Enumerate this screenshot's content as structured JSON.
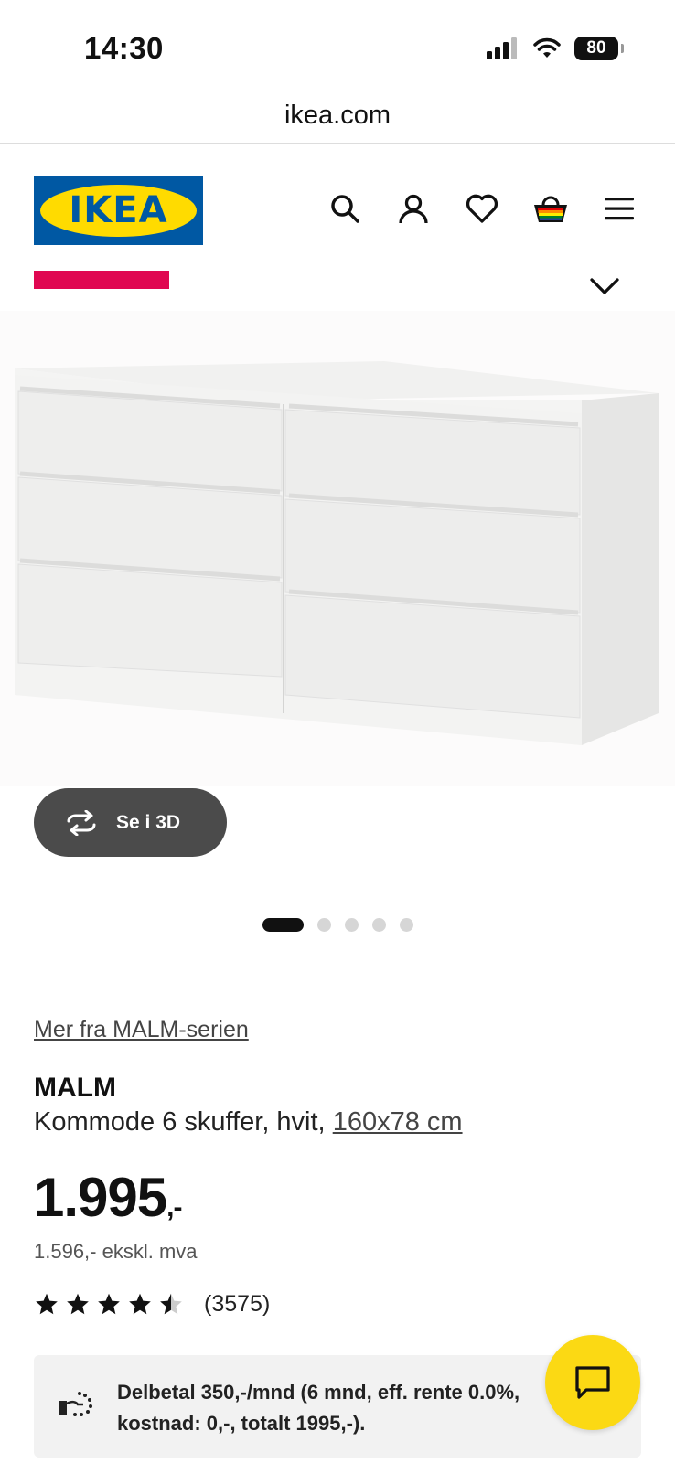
{
  "status": {
    "time": "14:30",
    "battery": "80"
  },
  "browser": {
    "url": "ikea.com"
  },
  "header": {
    "logo_text": "IKEA"
  },
  "gallery": {
    "view_3d_label": "Se i 3D",
    "slide_count": 5,
    "active_slide": 1
  },
  "product": {
    "series_link": "Mer fra MALM-serien",
    "name": "MALM",
    "description": "Kommode 6 skuffer, hvit, ",
    "dimensions": "160x78 cm",
    "price": "1.995",
    "price_suffix": ",-",
    "price_ex_vat": "1.596,- ekskl. mva",
    "rating_value": 4.5,
    "rating_max": 5,
    "rating_count": "(3575)"
  },
  "financing": {
    "text": "Delbetal 350,-/mnd (6 mnd, eff. rente 0.0%, kostnad: 0,-, totalt 1995,-)."
  },
  "colors": {
    "ikea_blue": "#0058a3",
    "ikea_yellow": "#ffdb00",
    "promo_red": "#e00751",
    "chat_yellow": "#fbd914"
  }
}
